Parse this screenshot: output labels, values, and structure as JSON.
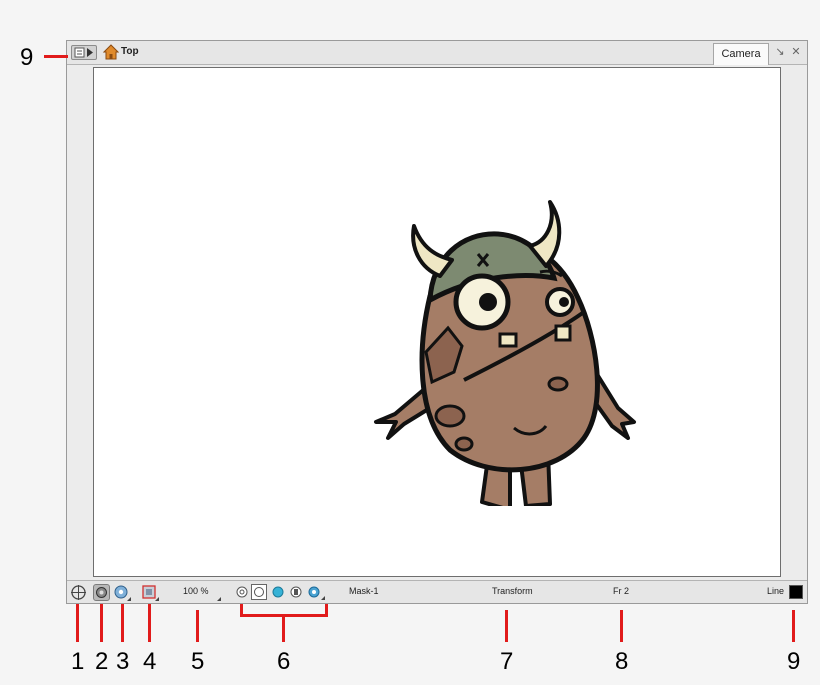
{
  "window": {
    "breadcrumb": "Top",
    "camera_tab": "Camera",
    "pin_glyph": "↘",
    "close_glyph": "✕"
  },
  "statusbar": {
    "zoom": "100 %",
    "mask": "Mask-1",
    "tool": "Transform",
    "frame": "Fr 2",
    "line_label": "Line",
    "line_color": "#000000",
    "mode_buttons": [
      "normal-mode",
      "colour-mode",
      "blue-mode",
      "matte-mode",
      "mix-mode"
    ],
    "selected_mode": "colour-mode"
  },
  "callouts": {
    "top_menu": "9",
    "items": [
      "1",
      "2",
      "3",
      "4",
      "5",
      "6",
      "7",
      "8",
      "9"
    ]
  },
  "colors": {
    "callout_red": "#e11b1b",
    "character_skin": "#a57d66",
    "character_helmet": "#7d8a71",
    "horn": "#efe7c4"
  }
}
